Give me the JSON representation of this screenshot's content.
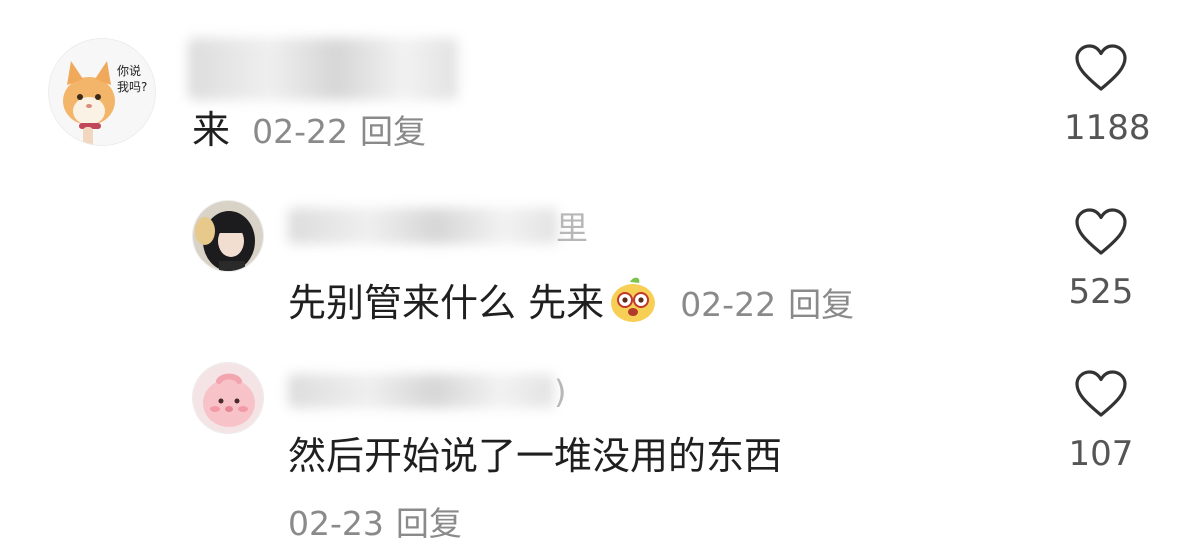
{
  "comments": [
    {
      "username_visible_suffix": "",
      "text": "来",
      "date": "02-22",
      "reply_label": "回复",
      "likes": "1188",
      "avatar_text": "你说\n我吗?"
    },
    {
      "username_visible_suffix": "里",
      "text": "先别管来什么 先来",
      "date": "02-22",
      "reply_label": "回复",
      "likes": "525"
    },
    {
      "username_visible_suffix": ")",
      "text": "然后开始说了一堆没用的东西",
      "date": "02-23",
      "reply_label": "回复",
      "likes": "107"
    }
  ],
  "colors": {
    "text": "#1f1f1f",
    "meta": "#8a8a8a",
    "like_count": "#555555",
    "heart_stroke": "#333333"
  },
  "icons": [
    "heart-outline-icon",
    "smiling-emoji-icon"
  ]
}
